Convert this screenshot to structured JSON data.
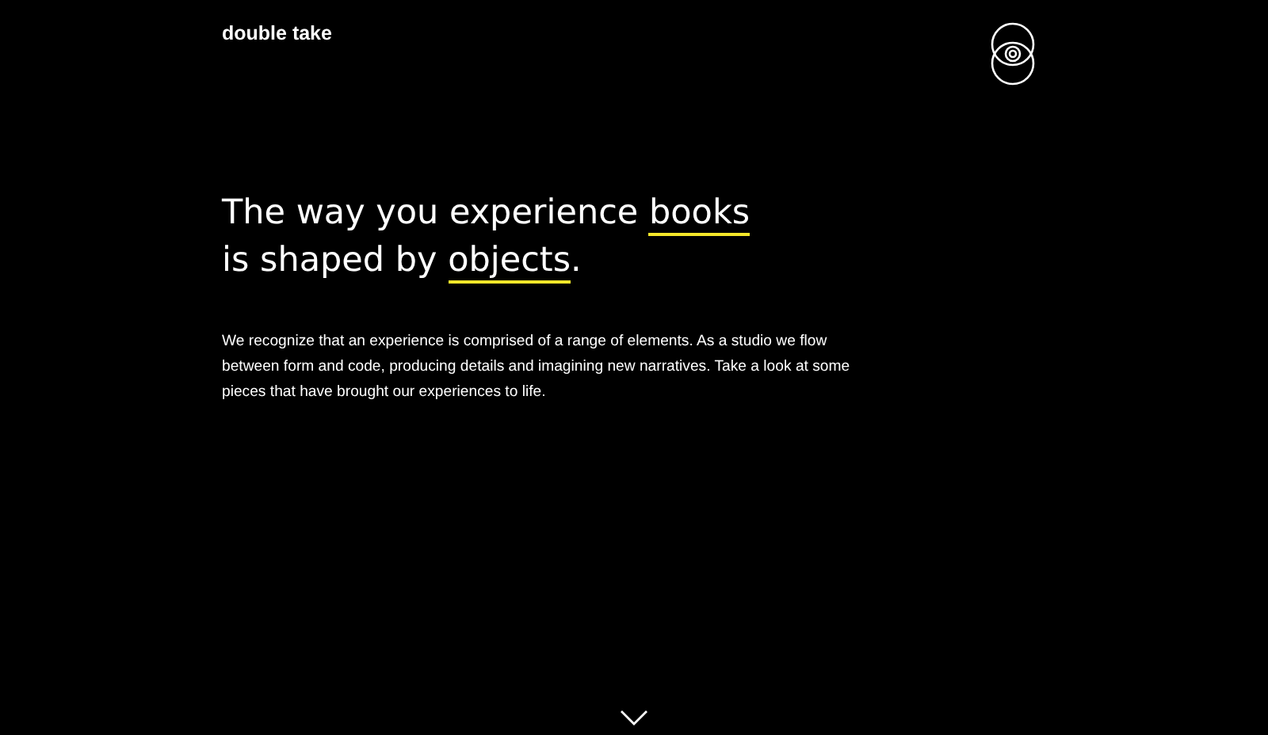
{
  "header": {
    "logo": "double take"
  },
  "headline": {
    "lines": [
      {
        "text": "The way you experience ",
        "link": "books"
      },
      {
        "text": "is shaped by ",
        "link": "objects",
        "after": "."
      }
    ]
  },
  "intro": "We recognize that an experience is comprised of a range of elements. As a studio we flow between form and code, producing details and imagining new narratives. Take a look at some pieces that have brought our experiences to life."
}
